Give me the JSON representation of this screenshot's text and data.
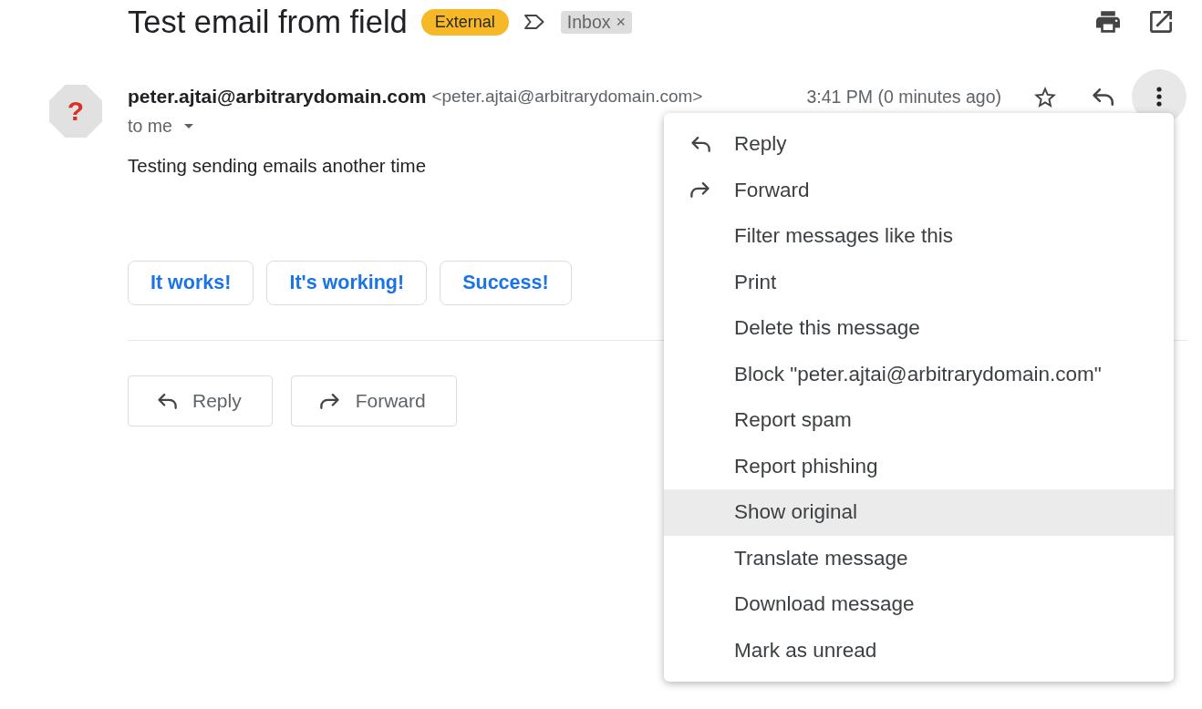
{
  "subject": {
    "title": "Test email from field",
    "tag": "External",
    "important": false,
    "folder_label": {
      "text": "Inbox",
      "remove": "×"
    }
  },
  "message": {
    "avatar_mark": "?",
    "sender_name": "peter.ajtai@arbitrarydomain.com",
    "sender_address": "<peter.ajtai@arbitrarydomain.com>",
    "time": "3:41 PM (0 minutes ago)",
    "starred": false,
    "recipient": "to me",
    "body": "Testing sending emails another time"
  },
  "smart_replies": [
    "It works!",
    "It's working!",
    "Success!"
  ],
  "actions": [
    {
      "kind": "reply",
      "label": "Reply"
    },
    {
      "kind": "forward",
      "label": "Forward"
    }
  ],
  "menu": {
    "open": true,
    "items": [
      {
        "kind": "reply",
        "label": "Reply",
        "selected": false
      },
      {
        "kind": "forward",
        "label": "Forward",
        "selected": false
      },
      {
        "kind": "plain",
        "label": "Filter messages like this",
        "selected": false
      },
      {
        "kind": "plain",
        "label": "Print",
        "selected": false
      },
      {
        "kind": "plain",
        "label": "Delete this message",
        "selected": false
      },
      {
        "kind": "plain",
        "label": "Block \"peter.ajtai@arbitrarydomain.com\"",
        "selected": false
      },
      {
        "kind": "plain",
        "label": "Report spam",
        "selected": false
      },
      {
        "kind": "plain",
        "label": "Report phishing",
        "selected": false
      },
      {
        "kind": "plain",
        "label": "Show original",
        "selected": true
      },
      {
        "kind": "plain",
        "label": "Translate message",
        "selected": false
      },
      {
        "kind": "plain",
        "label": "Download message",
        "selected": false
      },
      {
        "kind": "plain",
        "label": "Mark as unread",
        "selected": false
      }
    ]
  }
}
